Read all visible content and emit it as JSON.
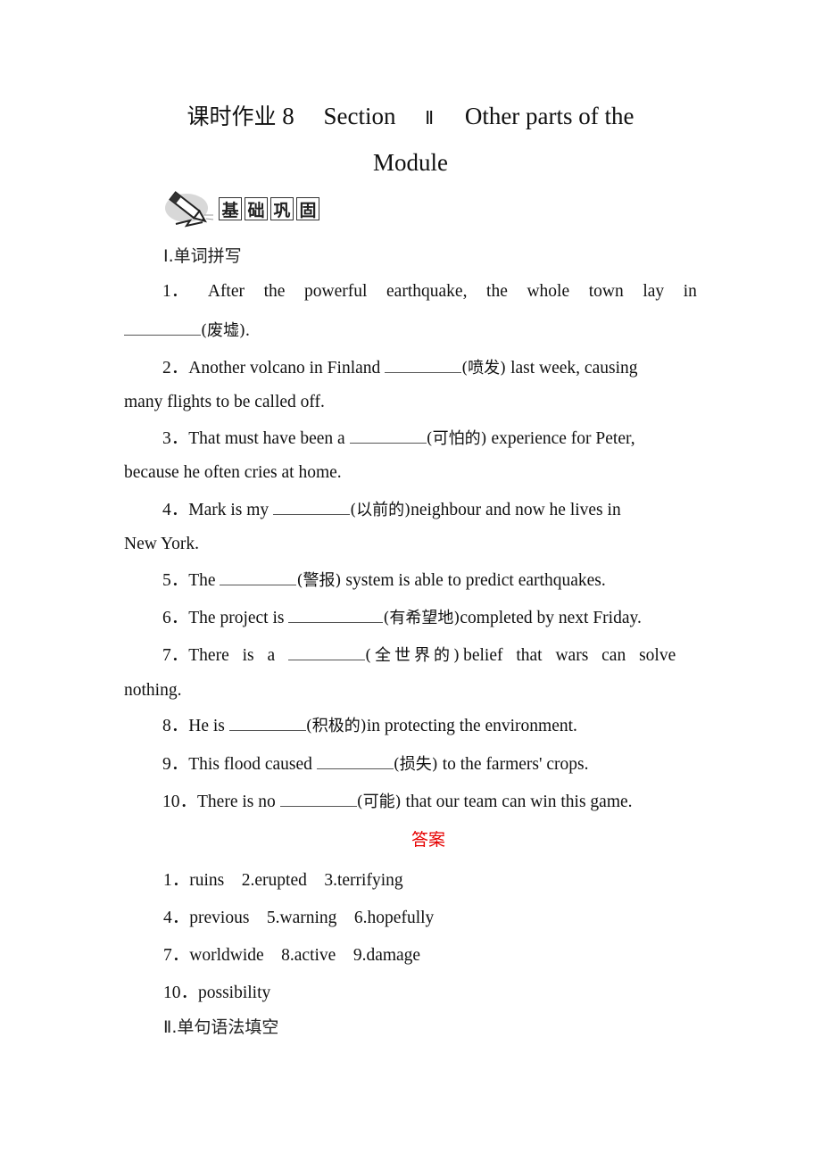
{
  "title": {
    "cn": "课时作业",
    "number": "8",
    "section": "Section",
    "roman": "Ⅱ",
    "subtitle_line1": "Other parts of the",
    "subtitle_line2": "Module"
  },
  "badge": {
    "icon": "pencil-icon",
    "chars": [
      "基",
      "础",
      "巩",
      "固"
    ]
  },
  "section1": {
    "heading": "Ⅰ.单词拼写",
    "questions": [
      {
        "num": "1．",
        "words": [
          "After",
          "the",
          "powerful",
          "earthquake,",
          "the",
          "whole",
          "town",
          "lay",
          "in"
        ],
        "line2_blank": "________",
        "line2_hint": "(废墟)",
        "line2_rest": "."
      },
      {
        "num": "2．",
        "pre": "Another volcano in Finland ",
        "blank": "________",
        "hint": "(喷发)",
        "post": " last week, causing",
        "cont": "many flights to be called off."
      },
      {
        "num": "3．",
        "pre": "That must have been a ",
        "blank": "________",
        "hint": "(可怕的)",
        "post": " experience for Peter,",
        "cont": "because he often cries at home."
      },
      {
        "num": "4．",
        "pre": "Mark is my ",
        "blank": "________",
        "hint": "(以前的)",
        "post": "neighbour and now he lives in",
        "cont": "New York."
      },
      {
        "num": "5．",
        "pre": "The ",
        "blank": "________",
        "hint": "(警报)",
        "post": " system is able to predict earthquakes."
      },
      {
        "num": "6．",
        "pre": "The project is ",
        "blank": "__________",
        "hint": "(有希望地)",
        "post": "completed by next Friday."
      },
      {
        "num": "7．",
        "pre": "There is a ",
        "blank": "________",
        "hint": "(全世界的)",
        "post": "belief that wars can solve",
        "cont": "nothing."
      },
      {
        "num": "8．",
        "pre": "He is ",
        "blank": "________",
        "hint": "(积极的)",
        "post": "in protecting the environment."
      },
      {
        "num": "9．",
        "pre": "This flood caused ",
        "blank": "________",
        "hint": "(损失)",
        "post": " to the farmers' crops."
      },
      {
        "num": "10．",
        "pre": "There is no ",
        "blank": "________",
        "hint": "(可能)",
        "post": " that our team can win this game."
      }
    ]
  },
  "answers": {
    "heading": "答案",
    "heading_color": "#e60000",
    "lines": [
      "1．ruins    2.erupted    3.terrifying",
      "4．previous    5.warning    6.hopefully",
      "7．worldwide    8.active    9.damage",
      "10．possibility"
    ]
  },
  "section2": {
    "heading": "Ⅱ.单句语法填空"
  }
}
